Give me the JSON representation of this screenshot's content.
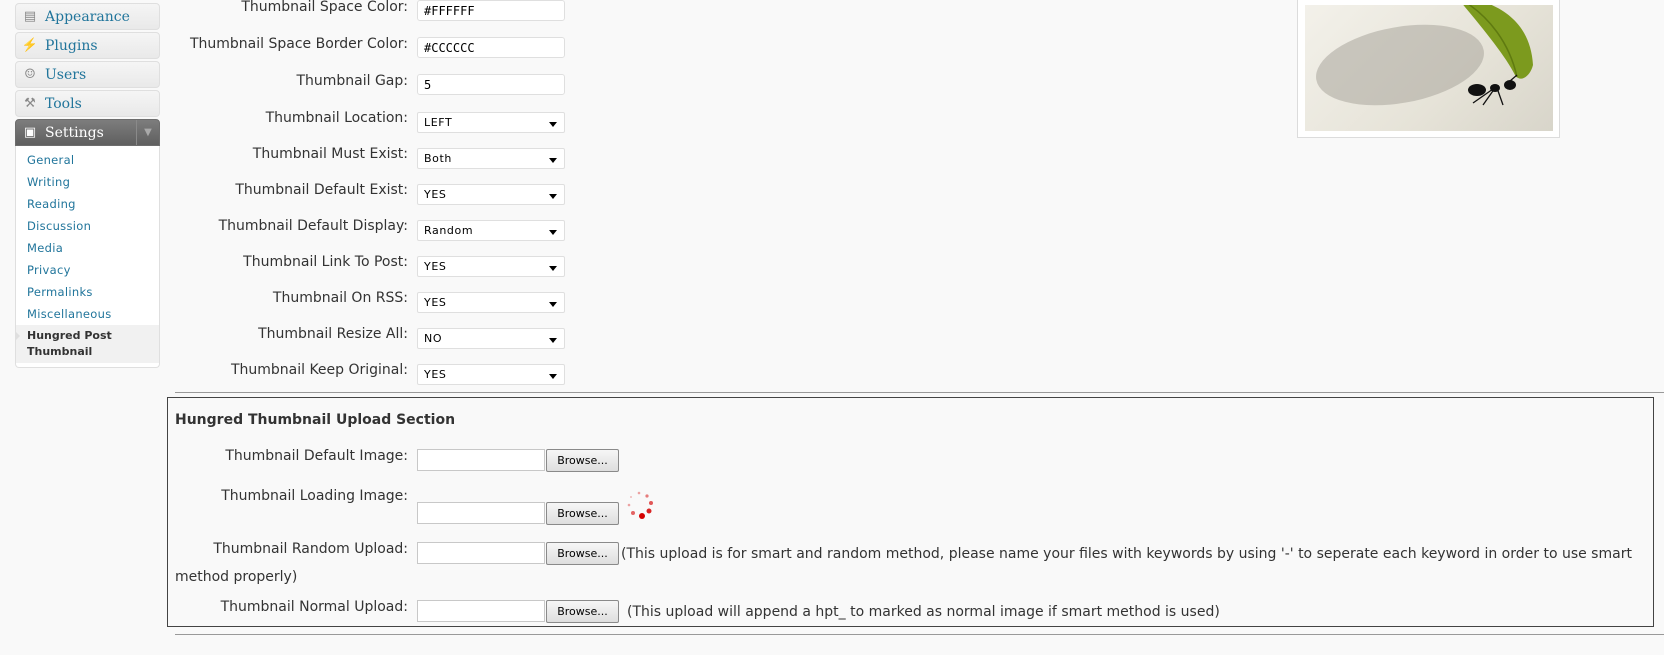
{
  "sidebar": {
    "items": [
      {
        "label": "Appearance",
        "icon": "appearance-icon"
      },
      {
        "label": "Plugins",
        "icon": "plugin-icon"
      },
      {
        "label": "Users",
        "icon": "users-icon"
      },
      {
        "label": "Tools",
        "icon": "tools-icon"
      },
      {
        "label": "Settings",
        "icon": "settings-icon"
      }
    ],
    "submenu": [
      "General",
      "Writing",
      "Reading",
      "Discussion",
      "Media",
      "Privacy",
      "Permalinks",
      "Miscellaneous"
    ],
    "current_sub_line1": "Hungred Post",
    "current_sub_line2": "Thumbnail"
  },
  "settings": {
    "space_color": {
      "label": "Thumbnail Space Color:",
      "value": "#FFFFFF"
    },
    "space_border_color": {
      "label": "Thumbnail Space Border Color:",
      "value": "#CCCCCC"
    },
    "gap": {
      "label": "Thumbnail Gap:",
      "value": "5"
    },
    "location": {
      "label": "Thumbnail Location:",
      "value": "LEFT"
    },
    "must_exist": {
      "label": "Thumbnail Must Exist:",
      "value": "Both"
    },
    "default_exist": {
      "label": "Thumbnail Default Exist:",
      "value": "YES"
    },
    "default_display": {
      "label": "Thumbnail Default Display:",
      "value": "Random"
    },
    "link_to_post": {
      "label": "Thumbnail Link To Post:",
      "value": "YES"
    },
    "on_rss": {
      "label": "Thumbnail On RSS:",
      "value": "YES"
    },
    "resize_all": {
      "label": "Thumbnail Resize All:",
      "value": "NO"
    },
    "keep_original": {
      "label": "Thumbnail Keep Original:",
      "value": "YES"
    }
  },
  "upload": {
    "title": "Hungred Thumbnail Upload Section",
    "browse_label": "Browse...",
    "default_image_label": "Thumbnail Default Image:",
    "loading_image_label": "Thumbnail Loading Image:",
    "random_upload_label": "Thumbnail Random Upload:",
    "random_note_line1": "(This upload is for smart and random method, please name your files with keywords by using '-' to seperate each keyword in order to use smart",
    "random_note_line2": "method properly)",
    "normal_upload_label": "Thumbnail Normal Upload:",
    "normal_note": "(This upload will append a hpt_ to marked as normal image if smart method is used)"
  },
  "colors": {
    "link": "#21759b",
    "settings_active_bg": "#6d6d6d",
    "spinner": "#d40000"
  }
}
